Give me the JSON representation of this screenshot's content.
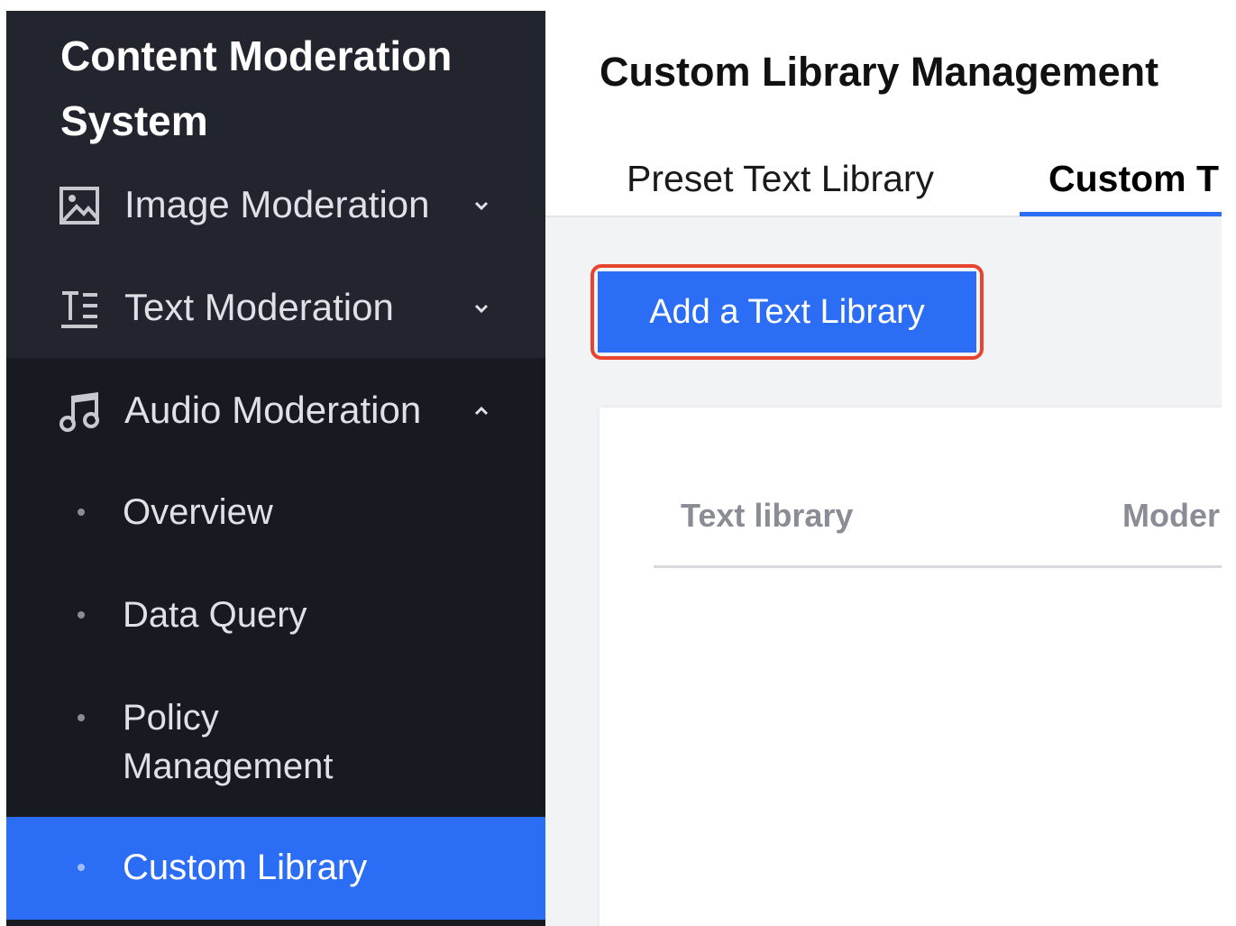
{
  "app": {
    "title": "Content Moderation System"
  },
  "sidebar": {
    "items": [
      {
        "label": "Image Moderation",
        "icon": "image-icon",
        "expanded": false
      },
      {
        "label": "Text Moderation",
        "icon": "text-icon",
        "expanded": false
      },
      {
        "label": "Audio Moderation",
        "icon": "music-note-icon",
        "expanded": true
      }
    ],
    "subitems": [
      {
        "label": "Overview",
        "active": false
      },
      {
        "label": "Data Query",
        "active": false
      },
      {
        "label": "Policy Management",
        "active": false
      },
      {
        "label": "Custom Library",
        "active": true
      }
    ]
  },
  "main": {
    "title": "Custom Library Management",
    "tabs": [
      {
        "label": "Preset Text Library",
        "active": false
      },
      {
        "label": "Custom T",
        "active": true
      }
    ],
    "add_button_label": "Add a Text Library",
    "table": {
      "columns": [
        "Text library",
        "Moder"
      ]
    }
  },
  "colors": {
    "sidebar_bg": "#171a21",
    "sidebar_top_bg": "#22252d",
    "accent": "#2b6ef5",
    "highlight": "#e8432e"
  }
}
